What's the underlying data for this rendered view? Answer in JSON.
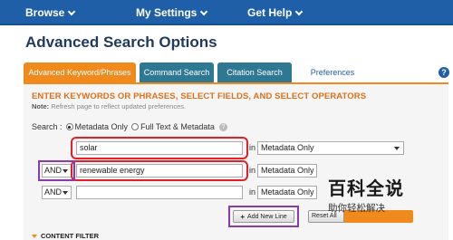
{
  "nav": {
    "browse": "Browse",
    "my_settings": "My Settings",
    "get_help": "Get Help"
  },
  "page_title": "Advanced Search Options",
  "tabs": {
    "advanced": "Advanced Keyword/Phrases",
    "command": "Command Search",
    "citation": "Citation Search",
    "preferences": "Preferences",
    "help": "?"
  },
  "panel": {
    "heading": "ENTER KEYWORDS OR PHRASES, SELECT FIELDS, AND SELECT OPERATORS",
    "note_label": "Note:",
    "note_text": "Refresh page to reflect updated preferences.",
    "search_label": "Search :",
    "radio_metadata_only": "Metadata Only",
    "radio_full_text": "Full Text & Metadata",
    "info": "?"
  },
  "rows": [
    {
      "operator": "",
      "term": "solar",
      "in": "in",
      "field": "Metadata Only"
    },
    {
      "operator": "AND",
      "term": "renewable energy",
      "in": "in",
      "field": "Metadata Only"
    },
    {
      "operator": "AND",
      "term": "",
      "in": "in",
      "field": "Metadata Only"
    }
  ],
  "buttons": {
    "add_new_line": "Add New Line",
    "reset": "Reset All"
  },
  "content_filter": "CONTENT FILTER",
  "watermark": {
    "big": "百科全说",
    "small": "助你轻松解决"
  },
  "colors": {
    "nav_bg": "#1f5fa8",
    "tab_active": "#f08a1c",
    "tab_inactive": "#2f7893",
    "highlight_red": "#e0202a",
    "highlight_purple": "#8a3ca8"
  }
}
